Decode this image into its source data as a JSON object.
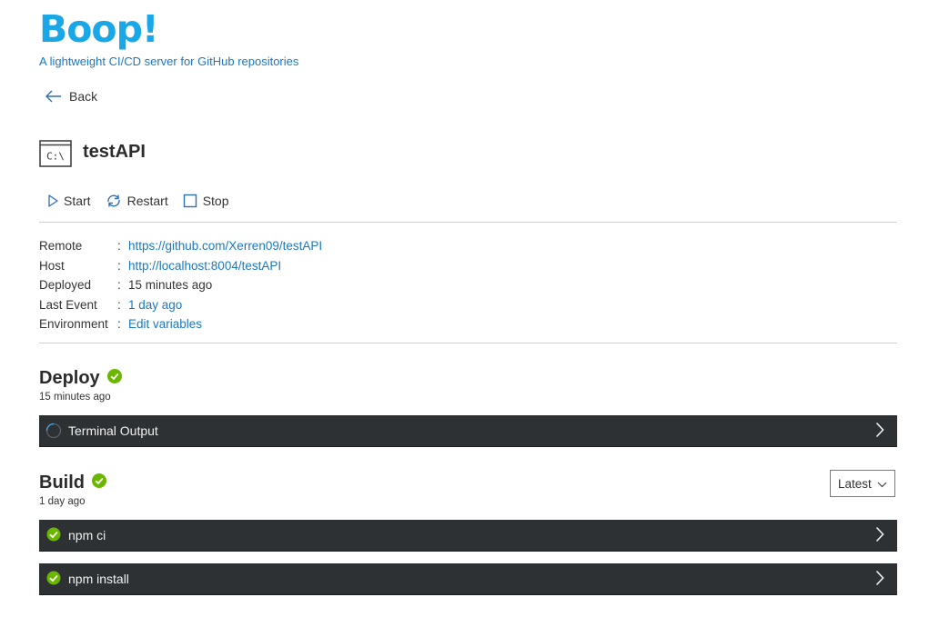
{
  "app": {
    "title": "Boop!",
    "tagline": "A lightweight CI/CD server for GitHub repositories"
  },
  "nav": {
    "back_label": "Back"
  },
  "repo": {
    "icon_text": "C:\\",
    "name": "testAPI"
  },
  "actions": {
    "start": "Start",
    "restart": "Restart",
    "stop": "Stop"
  },
  "details": [
    {
      "key": "Remote",
      "sep": ":",
      "value": "https://github.com/Xerren09/testAPI"
    },
    {
      "key": "Host",
      "sep": ":",
      "value": "http://localhost:8004/testAPI"
    },
    {
      "key": "Deployed",
      "sep": ":",
      "value": "15 minutes ago"
    },
    {
      "key": "Last Event",
      "sep": ":",
      "value": "1 day ago"
    },
    {
      "key": "Environment",
      "sep": ":",
      "value": "Edit variables"
    }
  ],
  "deploy": {
    "title": "Deploy",
    "time": "15 minutes ago",
    "steps": [
      {
        "label": "Terminal Output",
        "status": "running"
      }
    ]
  },
  "build": {
    "title": "Build",
    "time": "1 day ago",
    "version_select": "Latest",
    "steps": [
      {
        "label": "npm ci",
        "status": "success"
      },
      {
        "label": "npm install",
        "status": "success"
      }
    ]
  },
  "colors": {
    "brand": "#1aa7e8",
    "link": "#1a78c2",
    "success": "#6bb700",
    "bar": "#2d3134"
  }
}
